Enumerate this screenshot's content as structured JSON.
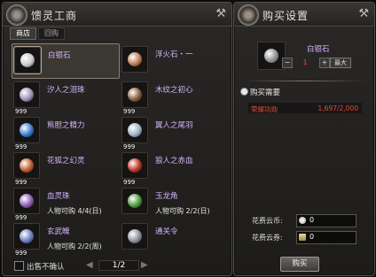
{
  "shop": {
    "title": "馈灵工商",
    "tools_icon": "crossed-tools-icon",
    "tabs": [
      "商店",
      "回购"
    ],
    "items": [
      {
        "name": "白银石",
        "qty": "",
        "limit": "",
        "icon": "silver-stone-icon",
        "color": "#c9c9c9",
        "selected": true
      },
      {
        "name": "浮火石・一",
        "qty": "",
        "limit": "",
        "icon": "fire-stone-icon",
        "color": "#c07a50"
      },
      {
        "name": "汐人之泪珠",
        "qty": "999",
        "limit": "",
        "icon": "teardrop-icon",
        "color": "#9a8fb8"
      },
      {
        "name": "木纹之初心",
        "qty": "999",
        "limit": "",
        "icon": "wood-grain-icon",
        "color": "#8a5a3a"
      },
      {
        "name": "熊胆之精力",
        "qty": "999",
        "limit": "",
        "icon": "blue-orb-icon",
        "color": "#3a7ad0"
      },
      {
        "name": "翼人之尾羽",
        "qty": "999",
        "limit": "",
        "icon": "feather-icon",
        "color": "#9ab0c8"
      },
      {
        "name": "花狐之幻灵",
        "qty": "999",
        "limit": "",
        "icon": "fox-spirit-icon",
        "color": "#c05a2a"
      },
      {
        "name": "狼人之赤血",
        "qty": "999",
        "limit": "",
        "icon": "red-blood-icon",
        "color": "#c03020"
      },
      {
        "name": "血灵珠",
        "qty": "999",
        "limit": "人物可购 4/4(日)",
        "icon": "purple-pearl-icon",
        "color": "#8a5ab0"
      },
      {
        "name": "玉龙角",
        "qty": "",
        "limit": "人物可购 2/2(日)",
        "icon": "jade-horn-icon",
        "color": "#4a9a3a"
      },
      {
        "name": "玄武魄",
        "qty": "999",
        "limit": "人物可购 2/2(周)",
        "icon": "xuanwu-soul-icon",
        "color": "#6a7ac0"
      },
      {
        "name": "通关令",
        "qty": "",
        "limit": "",
        "icon": "pass-token-icon",
        "color": "#8a8e98"
      }
    ],
    "footer": {
      "checkbox_label": "出售不确认",
      "page": "1/2"
    }
  },
  "settings": {
    "title": "购买设置",
    "item_name": "白银石",
    "qty_value": "1",
    "minus": "−",
    "plus": "+",
    "max_label": "最大",
    "req_header": "购买需要",
    "req_label": "荣耀功勋",
    "req_value": "1,697/2,000",
    "cost1_label": "花费云币:",
    "cost1_value": "0",
    "cost2_label": "花费云券:",
    "cost2_value": "0",
    "buy_label": "购买"
  }
}
